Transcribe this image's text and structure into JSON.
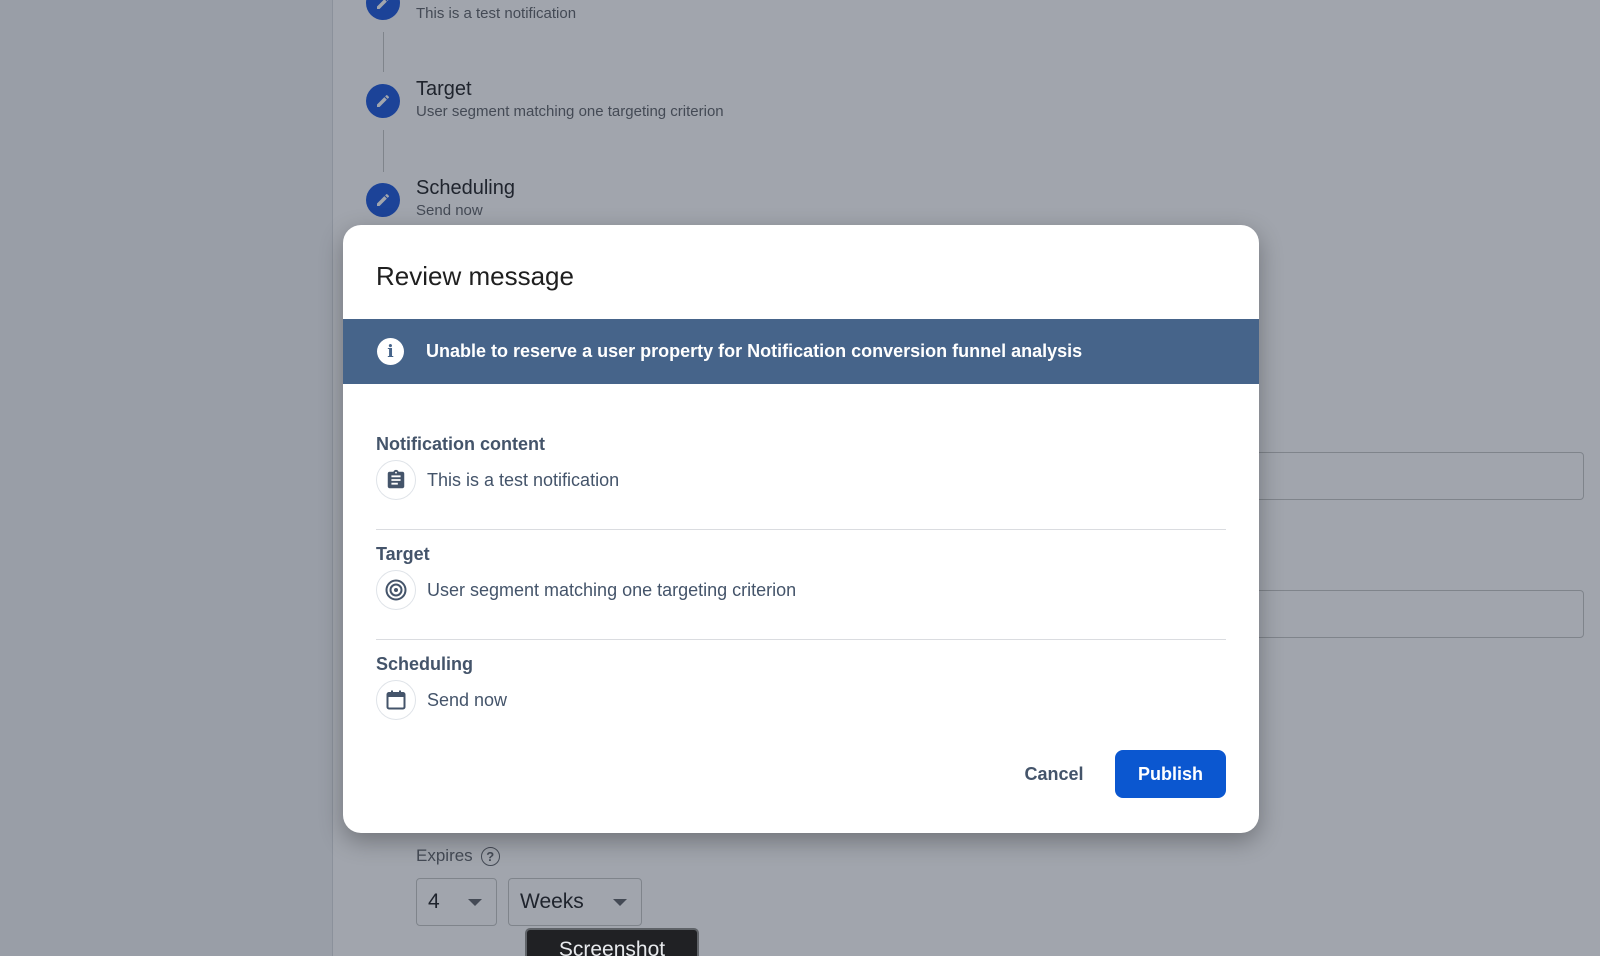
{
  "background": {
    "steps": [
      {
        "title": "",
        "subtitle": "This is a test notification"
      },
      {
        "title": "Target",
        "subtitle": "User segment matching one targeting criterion"
      },
      {
        "title": "Scheduling",
        "subtitle": "Send now"
      }
    ],
    "expires": {
      "label": "Expires",
      "help_icon": "?",
      "amount": "4",
      "unit": "Weeks"
    },
    "tooltip": "Screenshot"
  },
  "dialog": {
    "title": "Review message",
    "banner": {
      "icon": "info-icon",
      "text": "Unable to reserve a user property for Notification conversion funnel analysis"
    },
    "sections": [
      {
        "heading": "Notification content",
        "icon": "clipboard-icon",
        "value": "This is a test notification"
      },
      {
        "heading": "Target",
        "icon": "target-icon",
        "value": "User segment matching one targeting criterion"
      },
      {
        "heading": "Scheduling",
        "icon": "calendar-icon",
        "value": "Send now"
      }
    ],
    "buttons": {
      "cancel": "Cancel",
      "publish": "Publish"
    }
  },
  "colors": {
    "accent": "#0b57d0",
    "banner": "#46648a",
    "step_circle": "#1a56db"
  }
}
